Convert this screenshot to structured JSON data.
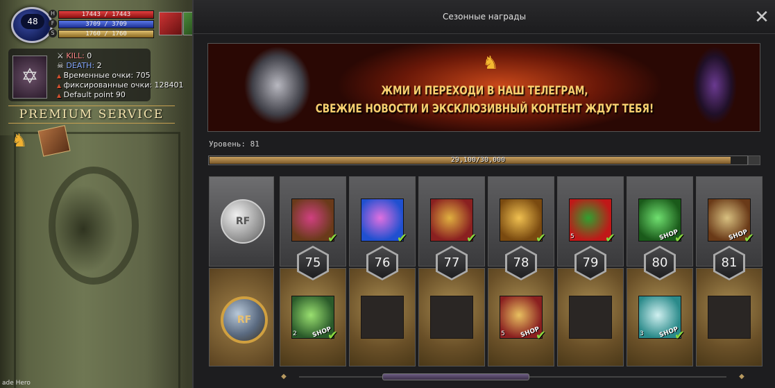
{
  "hud": {
    "level": "48",
    "hp": "17443 / 17443",
    "fp": "3709 / 3709",
    "sp": "1760 / 1760",
    "letters": [
      "H",
      "F",
      "S"
    ]
  },
  "stats": {
    "kill_label": "KILL:",
    "kill_value": "0",
    "death_label": "DEATH:",
    "death_value": "2",
    "temp_points": "Временные очки: 705",
    "fixed_points": "фиксированные очки: 128401",
    "default_point": "Default point 90"
  },
  "premium_label": "PREMIUM SERVICE",
  "character_name": "ade Hero",
  "window": {
    "title": "Сезонные награды",
    "close_glyph": "✕"
  },
  "banner": {
    "line1": "ЖМИ И ПЕРЕХОДИ В НАШ ТЕЛЕГРАМ,",
    "line2": "СВЕЖИЕ НОВОСТИ И ЭКСКЛЮЗИВНЫЙ КОНТЕНТ ЖДУТ ТЕБЯ!"
  },
  "level_label": "Уровень: 81",
  "progress": {
    "text": "29,100/30,000",
    "fraction": 0.97
  },
  "track_labels": {
    "free": "RF",
    "premium": "RF"
  },
  "columns": [
    {
      "level": "75",
      "free": {
        "icon": "treasure-chest-gems-icon",
        "colors": [
          "#6a3a1a",
          "#d04080"
        ],
        "qty": "",
        "shop": "",
        "claimed": true
      },
      "premium": {
        "icon": "green-armor-item-icon",
        "colors": [
          "#2a5a2a",
          "#9ae070"
        ],
        "qty": "2",
        "shop": "SHOP",
        "claimed": true
      }
    },
    {
      "level": "76",
      "free": {
        "icon": "blue-gift-box-icon",
        "colors": [
          "#2050d0",
          "#e070e0"
        ],
        "qty": "",
        "shop": "",
        "claimed": true
      },
      "premium": null
    },
    {
      "level": "77",
      "free": {
        "icon": "red-gold-chest-icon",
        "colors": [
          "#8a2020",
          "#e0b040"
        ],
        "qty": "",
        "shop": "",
        "claimed": true
      },
      "premium": null
    },
    {
      "level": "78",
      "free": {
        "icon": "golden-treasure-chest-icon",
        "colors": [
          "#7a4a10",
          "#f0c050"
        ],
        "qty": "",
        "shop": "",
        "claimed": true
      },
      "premium": {
        "icon": "dollar-gift-box-icon",
        "colors": [
          "#8a2020",
          "#e8c060"
        ],
        "qty": "5",
        "shop": "SHOP",
        "claimed": true
      }
    },
    {
      "level": "79",
      "free": {
        "icon": "red-present-icon",
        "colors": [
          "#c01818",
          "#30a030"
        ],
        "qty": "5",
        "shop": "",
        "claimed": true
      },
      "premium": null
    },
    {
      "level": "80",
      "free": {
        "icon": "level-boost-icon",
        "colors": [
          "#1a5a1a",
          "#70e070"
        ],
        "qty": "",
        "shop": "SHOP",
        "claimed": true
      },
      "premium": {
        "icon": "gem-ticket-icon",
        "colors": [
          "#2a8a8a",
          "#d0f0f0"
        ],
        "qty": "3",
        "shop": "SHOP",
        "claimed": true
      }
    },
    {
      "level": "81",
      "free": {
        "icon": "skull-scroll-icon",
        "colors": [
          "#6a3a18",
          "#d8c080"
        ],
        "qty": "",
        "shop": "SHOP",
        "claimed": true
      },
      "premium": null
    }
  ]
}
